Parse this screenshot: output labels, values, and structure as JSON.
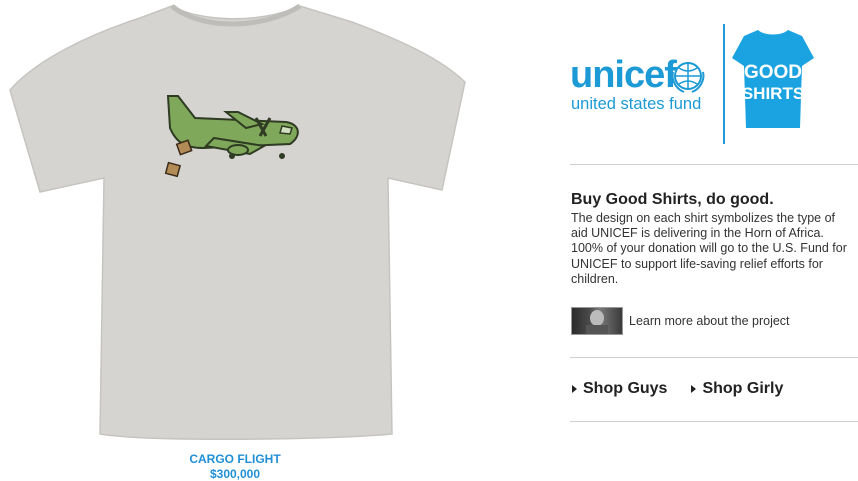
{
  "product": {
    "name": "CARGO FLIGHT",
    "price": "$300,000",
    "image_icon": "tshirt-cargo-plane-icon"
  },
  "brand": {
    "unicef_word": "unicef",
    "unicef_sub": "united states fund",
    "good_shirts_line1": "GOOD",
    "good_shirts_line2": "SHIRTS",
    "accent_color": "#1c9ad6"
  },
  "promo": {
    "title": "Buy Good Shirts, do good.",
    "body": "The design on each shirt symbolizes the type of aid UNICEF is delivering in the Horn of Africa. 100% of your donation will go to the U.S. Fund for UNICEF to support life-saving relief efforts for children.",
    "learn_more": "Learn more about the project"
  },
  "shop": {
    "guys": "Shop Guys",
    "girly": "Shop Girly"
  }
}
